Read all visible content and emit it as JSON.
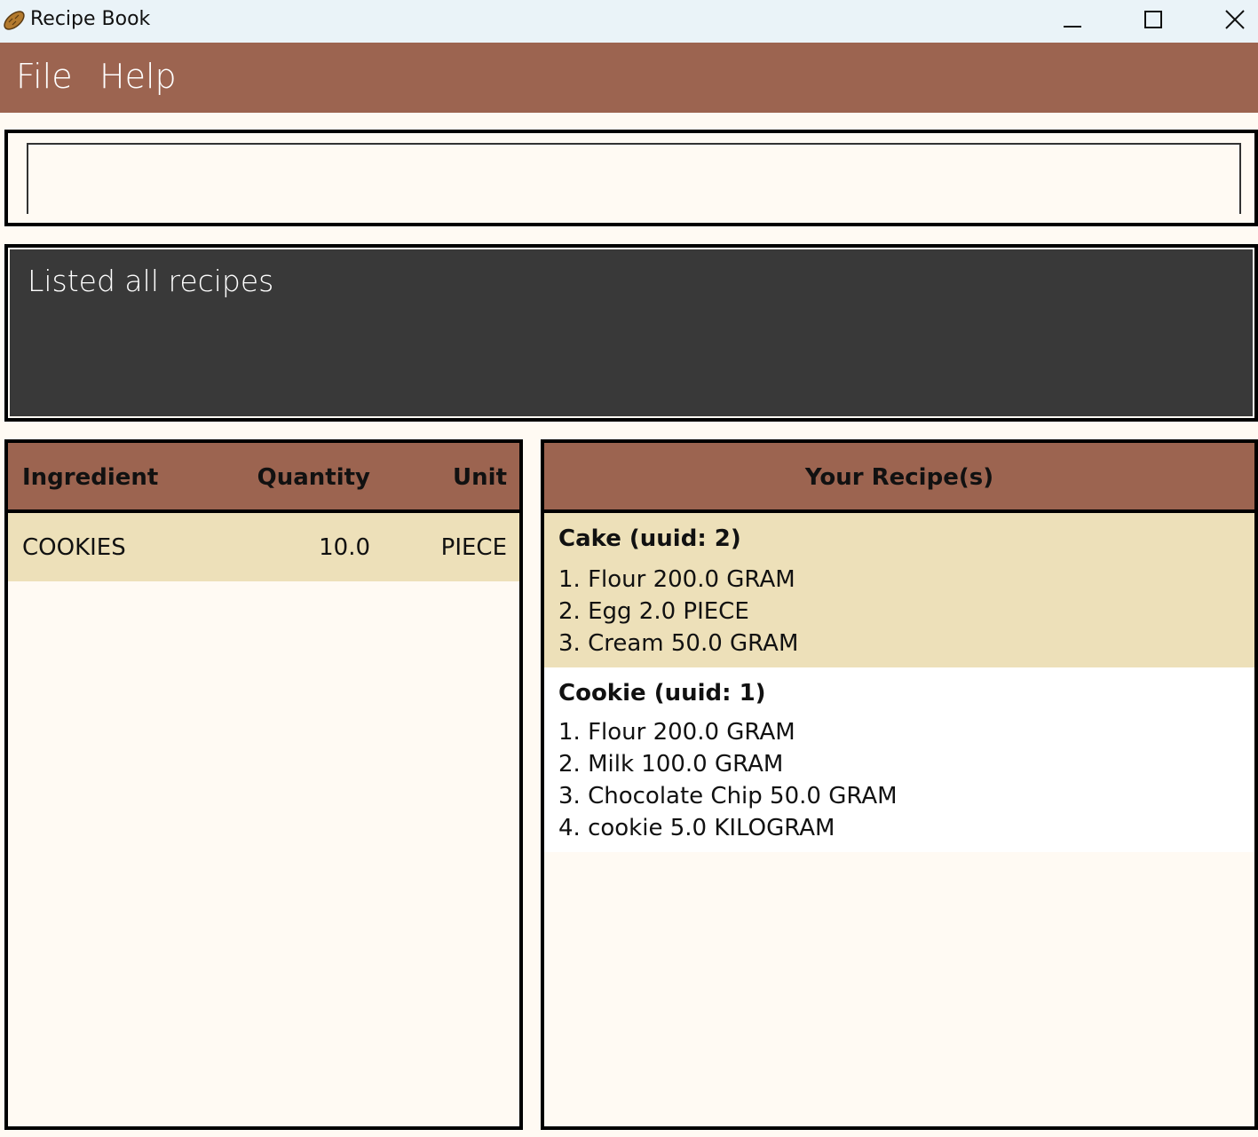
{
  "window": {
    "title": "Recipe Book",
    "icon": "bread-icon",
    "controls": [
      "minimize-icon",
      "maximize-icon",
      "close-icon"
    ]
  },
  "menu": {
    "file_label": "File",
    "help_label": "Help"
  },
  "command": {
    "value": "",
    "placeholder": ""
  },
  "result": {
    "message": "Listed all recipes"
  },
  "ingredients": {
    "columns": [
      "Ingredient",
      "Quantity",
      "Unit"
    ],
    "rows": [
      {
        "name": "COOKIES",
        "quantity": "10.0",
        "unit": "PIECE"
      }
    ]
  },
  "recipes": {
    "header": "Your Recipe(s)",
    "items": [
      {
        "title": "Cake (uuid: 2)",
        "ingredients": [
          "1. Flour 200.0 GRAM",
          "2. Egg 2.0 PIECE",
          "3. Cream 50.0 GRAM"
        ]
      },
      {
        "title": "Cookie (uuid: 1)",
        "ingredients": [
          "1. Flour 200.0 GRAM",
          "2. Milk 100.0 GRAM",
          "3. Chocolate Chip 50.0 GRAM",
          "4. cookie 5.0 KILOGRAM"
        ]
      }
    ]
  },
  "colors": {
    "menu_bar": "#9c6450",
    "selected_row": "#ede0b9",
    "result_bg": "#393939",
    "page_bg": "#fffaf3"
  }
}
